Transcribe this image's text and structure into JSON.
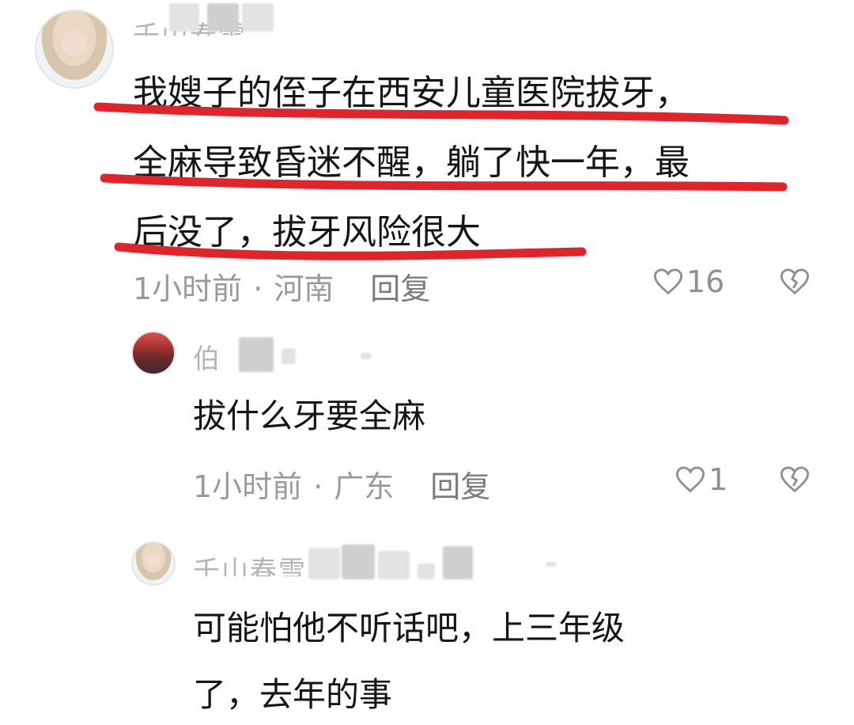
{
  "main_comment": {
    "username": "千山春雪",
    "lines": [
      "我嫂子的侄子在西安儿童医院拔牙，",
      "全麻导致昏迷不醒，躺了快一年，最",
      "后没了，拔牙风险很大"
    ],
    "time": "1小时前",
    "location": "河南",
    "reply_label": "回复",
    "likes": "16",
    "underline_color": "#e1242b"
  },
  "replies": [
    {
      "username": "伯",
      "text_lines": [
        "拔什么牙要全麻"
      ],
      "time": "1小时前",
      "location": "广东",
      "reply_label": "回复",
      "likes": "1"
    },
    {
      "username": "千山春雪",
      "text_lines": [
        "可能怕他不听话吧，上三年级",
        "了，去年的事"
      ]
    }
  ],
  "meta_separator": "·"
}
